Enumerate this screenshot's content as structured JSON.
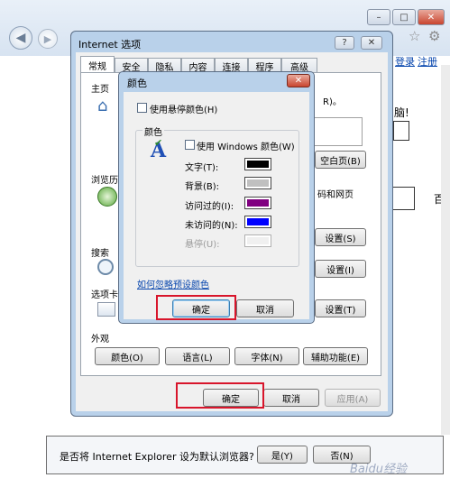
{
  "browser": {
    "controls": {
      "minimize": "–",
      "restore": "□",
      "close": "✕"
    },
    "right_links": {
      "login": "登录",
      "register": "注册"
    },
    "page_fragments": {
      "exclaim": "脑!",
      "bai": "百"
    }
  },
  "internet_options": {
    "title": "Internet 选项",
    "help_btn": "?",
    "close_btn": "✕",
    "tabs": [
      "常规",
      "安全",
      "隐私",
      "内容",
      "连接",
      "程序",
      "高级"
    ],
    "sections": {
      "home": "主页",
      "history": "浏览历",
      "search": "搜索",
      "tabs": "选项卡",
      "appearance": "外观"
    },
    "fragments": {
      "home_text": "R)。",
      "blank_btn": "空白页(B)",
      "history_text": "码和网页"
    },
    "settings_buttons": [
      "设置(S)",
      "设置(I)",
      "设置(T)"
    ],
    "appearance_buttons": [
      "颜色(O)",
      "语言(L)",
      "字体(N)",
      "辅助功能(E)"
    ],
    "footer": {
      "ok": "确定",
      "cancel": "取消",
      "apply": "应用(A)"
    }
  },
  "color_dialog": {
    "title": "颜色",
    "close_btn": "✕",
    "use_hover": "使用悬停颜色(H)",
    "group_title": "颜色",
    "use_windows": "使用 Windows 颜色(W)",
    "rows": [
      {
        "label": "文字(T):",
        "color": "#000000",
        "enabled": true
      },
      {
        "label": "背景(B):",
        "color": "#c0c0c0",
        "enabled": true
      },
      {
        "label": "访问过的(I):",
        "color": "#800080",
        "enabled": true
      },
      {
        "label": "未访问的(N):",
        "color": "#0000ff",
        "enabled": true
      },
      {
        "label": "悬停(U):",
        "color": "#f0f0f0",
        "enabled": false
      }
    ],
    "link": "如何忽略预设颜色",
    "ok": "确定",
    "cancel": "取消"
  },
  "notification": {
    "question": "是否将 Internet Explorer 设为默认浏览器?",
    "yes": "是(Y)",
    "no": "否(N)"
  },
  "watermark": "Baidu经验",
  "colors": {
    "highlight": "#d8152b",
    "link": "#0645ad",
    "dialog_frame": "#b9d1ea"
  }
}
